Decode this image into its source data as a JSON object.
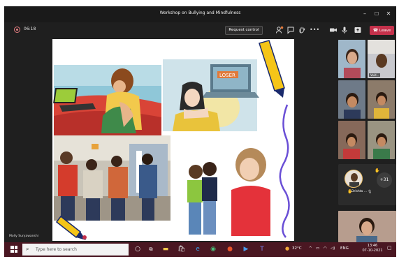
{
  "window": {
    "title": "Workshop on Bullying and Mindfulness",
    "minimize_icon": "minimize-icon",
    "maximize_icon": "maximize-icon",
    "close_icon": "close-icon"
  },
  "toolbar": {
    "timer": "06:18",
    "request_control_label": "Request control",
    "participants_badge": "",
    "leave_label": "Leave",
    "leave_color": "#c4314b",
    "icons": [
      "participants-icon",
      "chat-icon",
      "raise-hand-icon",
      "more-icon",
      "camera-icon",
      "mic-icon",
      "share-icon",
      "phone-icon"
    ]
  },
  "stage": {
    "presenter_name": "Molly Suryawanshi",
    "slide_images": [
      "girl-on-bed-with-laptop",
      "girl-with-laptop-bully-screen",
      "school-hallway-bullying",
      "girls-whispering-and-sad-girl",
      "pencil-top-right",
      "pencil-bottom-left",
      "purple-wavy-line"
    ]
  },
  "participants": {
    "tiles": [
      {
        "label": ""
      },
      {
        "label": "Vaid..."
      },
      {
        "label": ""
      },
      {
        "label": ""
      },
      {
        "label": ""
      },
      {
        "label": ""
      },
      {
        "label": ""
      }
    ],
    "avatar_name": "Drishta ...",
    "more_count": "+31"
  },
  "taskbar": {
    "search_placeholder": "Type here to search",
    "weather": "32°C",
    "language": "ENG",
    "time": "13:46",
    "date": "07-10-2021",
    "bg_color": "#4a1722"
  }
}
